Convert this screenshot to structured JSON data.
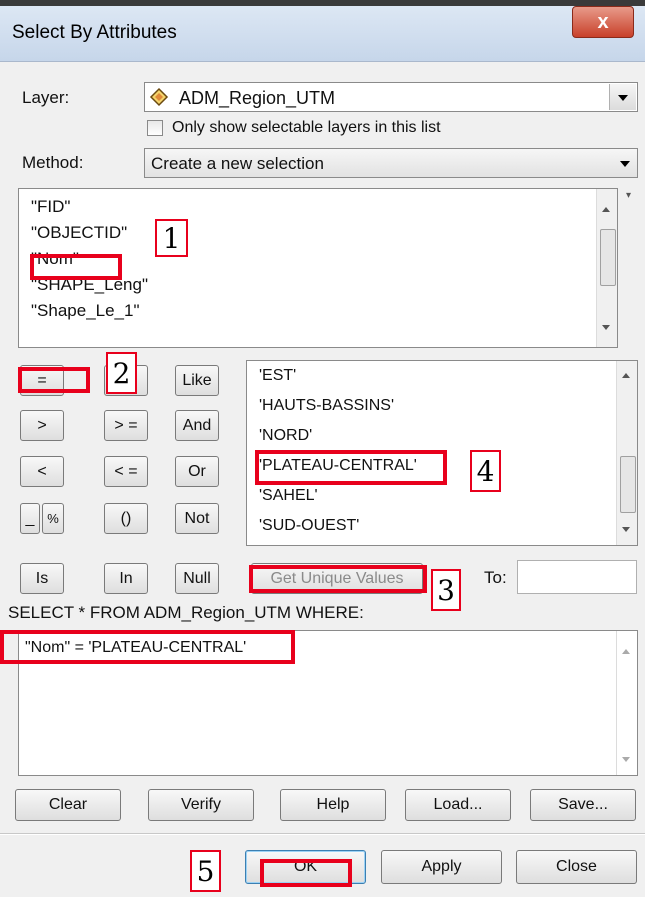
{
  "window": {
    "title": "Select By Attributes",
    "close_glyph": "x"
  },
  "layer": {
    "label": "Layer:",
    "value": "ADM_Region_UTM",
    "icon": "diamond-layer-icon"
  },
  "only_selectable": {
    "label": "Only show selectable layers in this list",
    "checked": false
  },
  "method": {
    "label": "Method:",
    "value": "Create a new selection"
  },
  "fields": [
    "\"FID\"",
    "\"OBJECTID\"",
    "\"Nom\"",
    "\"SHAPE_Leng\"",
    "\"Shape_Le_1\""
  ],
  "operators": {
    "eq": "=",
    "ne": "<>",
    "like": "Like",
    "gt": ">",
    "ge": "> =",
    "and": "And",
    "lt": "<",
    "le": "< =",
    "or": "Or",
    "underscore": "_",
    "percent": "%",
    "parens": "()",
    "not": "Not",
    "is": "Is",
    "in": "In",
    "null": "Null"
  },
  "values": [
    "'EST'",
    "'HAUTS-BASSINS'",
    "'NORD'",
    "'PLATEAU-CENTRAL'",
    "'SAHEL'",
    "'SUD-OUEST'"
  ],
  "get_unique_values": "Get Unique Values",
  "goto_label": "To:",
  "goto_value": "",
  "query_label": "SELECT * FROM ADM_Region_UTM WHERE:",
  "query_text": "\"Nom\" = 'PLATEAU-CENTRAL'",
  "buttons": {
    "clear": "Clear",
    "verify": "Verify",
    "help": "Help",
    "load": "Load...",
    "save": "Save...",
    "ok": "OK",
    "apply": "Apply",
    "close": "Close"
  },
  "annotations": [
    "1",
    "2",
    "3",
    "4",
    "5"
  ],
  "colors": {
    "highlight": "#e8001c"
  }
}
